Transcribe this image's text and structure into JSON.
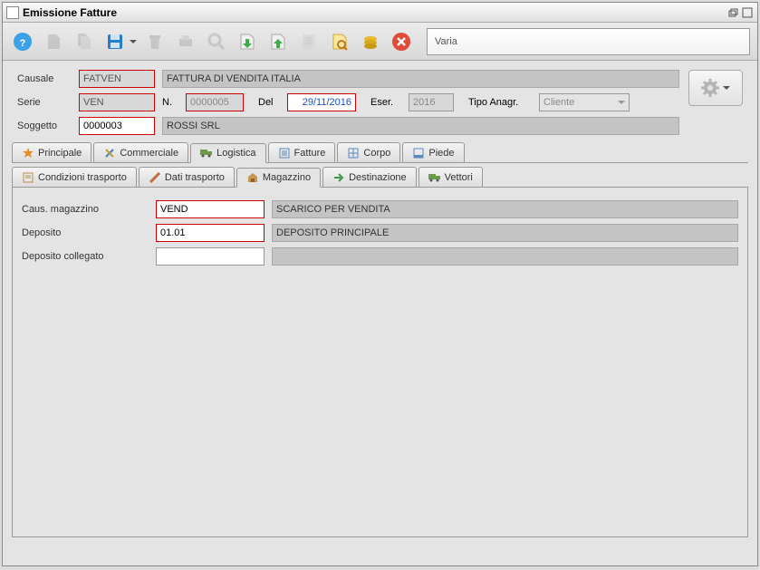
{
  "window": {
    "title": "Emissione Fatture"
  },
  "toolbar": {
    "varia": "Varia"
  },
  "header": {
    "causale_label": "Causale",
    "causale": "FATVEN",
    "causale_desc": "FATTURA DI VENDITA ITALIA",
    "serie_label": "Serie",
    "serie": "VEN",
    "n_label": "N.",
    "n": "0000005",
    "del_label": "Del",
    "del": "29/11/2016",
    "eser_label": "Eser.",
    "eser": "2016",
    "tipo_label": "Tipo Anagr.",
    "tipo": "Cliente",
    "soggetto_label": "Soggetto",
    "soggetto": "0000003",
    "soggetto_desc": "ROSSI SRL"
  },
  "tabs": {
    "principale": "Principale",
    "commerciale": "Commerciale",
    "logistica": "Logistica",
    "fatture": "Fatture",
    "corpo": "Corpo",
    "piede": "Piede"
  },
  "subtabs": {
    "condizioni": "Condizioni trasporto",
    "dati": "Dati trasporto",
    "magazzino": "Magazzino",
    "destinazione": "Destinazione",
    "vettori": "Vettori"
  },
  "content": {
    "caus_label": "Caus. magazzino",
    "caus": "VEND",
    "caus_desc": "SCARICO PER VENDITA",
    "deposito_label": "Deposito",
    "deposito": "01.01",
    "deposito_desc": "DEPOSITO PRINCIPALE",
    "deposito_coll_label": "Deposito collegato",
    "deposito_coll": "",
    "deposito_coll_desc": ""
  }
}
